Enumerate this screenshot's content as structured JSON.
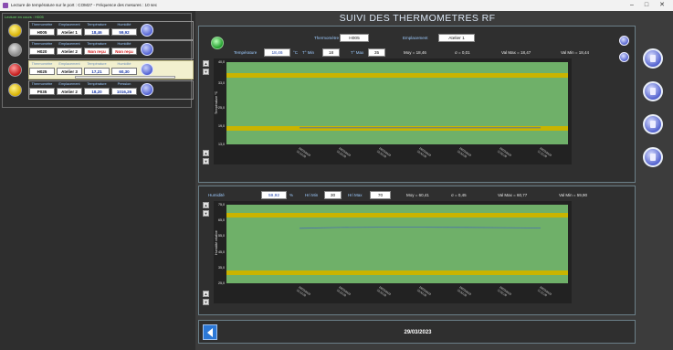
{
  "window": {
    "title": "Lecture de température sur le port : COM27 - Fréquence des mesures : 10 sec",
    "minimize": "–",
    "maximize": "□",
    "close": "✕"
  },
  "sidebar": {
    "reading_label": "Lecture en cours : H005",
    "sensors": [
      {
        "status": "yellow",
        "h": [
          "Thermomètre",
          "Emplacement",
          "Température",
          "Humidité"
        ],
        "v": [
          "H005",
          "Atelier 1",
          "18,46",
          "59,92"
        ],
        "hl": false
      },
      {
        "status": "gray",
        "h": [
          "Thermomètre",
          "Emplacement",
          "Température",
          "Humidité"
        ],
        "v": [
          "H020",
          "Atelier 2",
          "Non reçu",
          "Non reçu"
        ],
        "hl": false
      },
      {
        "status": "red",
        "h": [
          "Thermomètre",
          "Emplacement",
          "Température",
          "Humidité"
        ],
        "v": [
          "H025",
          "Atelier 3",
          "17,21",
          "60,30"
        ],
        "hl": true
      },
      {
        "status": "yellow",
        "h": [
          "Thermomètre",
          "Emplacement",
          "Température",
          "Pression"
        ],
        "v": [
          "P035",
          "Atelier 2",
          "18,20",
          "1016,26"
        ],
        "hl": false
      }
    ]
  },
  "main": {
    "title": "SUIVI DES THERMOMETRES RF",
    "thermo_label": "Thermomètre",
    "thermo_value": "H005",
    "emplacement_label": "Emplacement",
    "emplacement_value": "Atelier 1",
    "temp": {
      "label": "Température",
      "value": "18,46",
      "unit": "°C",
      "min_label": "T° Min",
      "min": "18",
      "max_label": "T° Max",
      "max": "35",
      "moy": "Moy = 18,46",
      "sigma": "σ = 0,01",
      "valmax": "Val Max = 18,47",
      "valmin": "Val Min = 18,44"
    },
    "hum": {
      "label": "Humidité",
      "value": "59,92",
      "unit": "%",
      "min_label": "Hri Min",
      "min": "30",
      "max_label": "Hri Max",
      "max": "70",
      "moy": "Moy = 60,41",
      "sigma": "σ = 0,45",
      "valmax": "Val Max = 60,77",
      "valmin": "Val Min = 59,90"
    },
    "date": "29/03/2023"
  },
  "chart_data": [
    {
      "type": "line",
      "ylabel": "Température °C",
      "ylim": [
        13.0,
        40.0
      ],
      "yticks": [
        "40,0",
        "33,0",
        "25,0",
        "19,0",
        "13,0"
      ],
      "bands": {
        "warn_hi": [
          35,
          36.5
        ],
        "warn_lo": [
          17.5,
          19
        ]
      },
      "x": [
        "29/03/2023 10:12:26",
        "29/03/2023 10:22:26",
        "29/03/2023 10:32:26",
        "29/03/2023 10:42:26",
        "29/03/2023 10:52:26",
        "29/03/2023 11:02:26",
        "29/03/2023 11:12:26"
      ],
      "series": [
        {
          "values": [
            18.45,
            18.46,
            18.46,
            18.46,
            18.47,
            18.46,
            18.46
          ]
        }
      ],
      "colors": {
        "bg": "#6fb069",
        "band": "#c9b400",
        "line": "#4a6fb0"
      }
    },
    {
      "type": "line",
      "ylabel": "Humidité relative",
      "ylim": [
        25.0,
        75.0
      ],
      "yticks": [
        "75,0",
        "65,0",
        "55,0",
        "45,0",
        "35,0",
        "25,0"
      ],
      "bands": {
        "warn_hi": [
          67,
          70
        ],
        "warn_lo": [
          30,
          33
        ]
      },
      "x": [
        "29/03/2023 10:12:26",
        "29/03/2023 10:22:26",
        "29/03/2023 10:32:26",
        "29/03/2023 10:42:26",
        "29/03/2023 10:52:26",
        "29/03/2023 11:02:26",
        "29/03/2023 11:12:26"
      ],
      "series": [
        {
          "values": [
            60.0,
            60.5,
            60.7,
            60.7,
            60.6,
            60.4,
            60.2
          ]
        }
      ],
      "colors": {
        "bg": "#6fb069",
        "band": "#c9b400",
        "line": "#4a6fb0"
      }
    }
  ]
}
